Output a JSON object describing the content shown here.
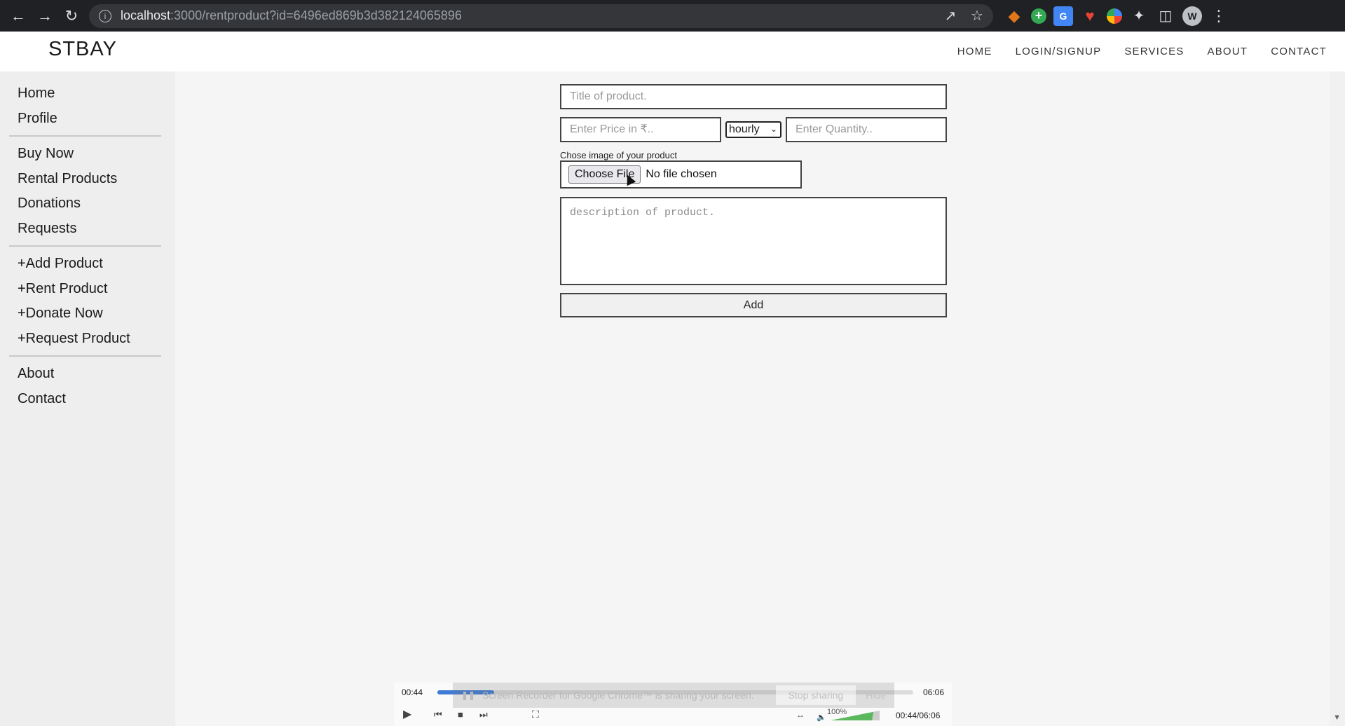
{
  "browser": {
    "url_host": "localhost",
    "url_path": ":3000/rentproduct?id=6496ed869b3d382124065896"
  },
  "site": {
    "brand": "STBAY",
    "topnav": [
      "HOME",
      "LOGIN/SIGNUP",
      "SERVICES",
      "ABOUT",
      "CONTACT"
    ]
  },
  "sidebar": {
    "group1": [
      "Home",
      "Profile"
    ],
    "group2": [
      "Buy Now",
      "Rental Products",
      "Donations",
      "Requests"
    ],
    "group3": [
      "+Add Product",
      "+Rent Product",
      "+Donate Now",
      "+Request Product"
    ],
    "group4": [
      "About",
      "Contact"
    ]
  },
  "form": {
    "title_placeholder": "Title of product.",
    "price_placeholder": "Enter Price in ₹..",
    "rate_selected": "hourly",
    "quantity_placeholder": "Enter Quantity..",
    "image_label": "Chose image of your product",
    "choose_file_label": "Choose File",
    "no_file_text": "No file chosen",
    "description_placeholder": "description of product.",
    "submit_label": "Add"
  },
  "player": {
    "current_time": "00:44",
    "total_time": "06:06",
    "elapsed_of_total": "00:44/06:06",
    "progress": 0.12,
    "volume_text": "100%",
    "share_notice": "Screen Recorder for Google Chrome™ is sharing your screen.",
    "stop_sharing_label": "Stop sharing",
    "hide_label": "Hide"
  }
}
